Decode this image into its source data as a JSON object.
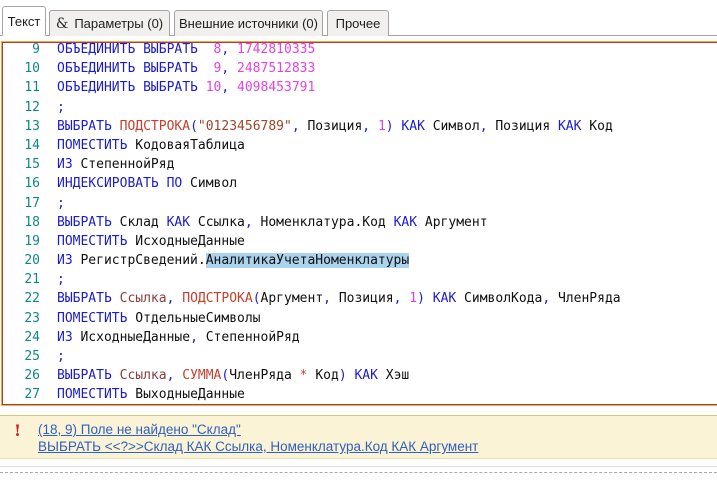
{
  "tabs": [
    {
      "label": "Текст",
      "active": true
    },
    {
      "label": "Параметры (0)",
      "icon_glyph": "&",
      "active": false
    },
    {
      "label": "Внешние источники (0)",
      "active": false
    },
    {
      "label": "Прочее",
      "active": false
    }
  ],
  "editor": {
    "lines": [
      {
        "n": "9",
        "tokens": [
          [
            "kw",
            "ОБЪЕДИНИТЬ ВЫБРАТЬ"
          ],
          [
            "id",
            "  "
          ],
          [
            "num",
            "8"
          ],
          [
            "pun",
            ", "
          ],
          [
            "num",
            "1742810335"
          ]
        ]
      },
      {
        "n": "10",
        "tokens": [
          [
            "kw",
            "ОБЪЕДИНИТЬ ВЫБРАТЬ"
          ],
          [
            "id",
            "  "
          ],
          [
            "num",
            "9"
          ],
          [
            "pun",
            ", "
          ],
          [
            "num",
            "2487512833"
          ]
        ]
      },
      {
        "n": "11",
        "tokens": [
          [
            "kw",
            "ОБЪЕДИНИТЬ ВЫБРАТЬ"
          ],
          [
            "id",
            " "
          ],
          [
            "num",
            "10"
          ],
          [
            "pun",
            ", "
          ],
          [
            "num",
            "4098453791"
          ]
        ]
      },
      {
        "n": "12",
        "tokens": [
          [
            "pun",
            ";"
          ]
        ]
      },
      {
        "n": "13",
        "tokens": [
          [
            "kw",
            "ВЫБРАТЬ"
          ],
          [
            "id",
            " "
          ],
          [
            "fn",
            "ПОДСТРОКА"
          ],
          [
            "pun",
            "("
          ],
          [
            "str",
            "\"0123456789\""
          ],
          [
            "pun",
            ", "
          ],
          [
            "id",
            "Позиция"
          ],
          [
            "pun",
            ", "
          ],
          [
            "num",
            "1"
          ],
          [
            "pun",
            ") "
          ],
          [
            "kw",
            "КАК"
          ],
          [
            "id",
            " Символ"
          ],
          [
            "pun",
            ","
          ],
          [
            "id",
            " Позиция "
          ],
          [
            "kw",
            "КАК"
          ],
          [
            "id",
            " Код"
          ]
        ]
      },
      {
        "n": "14",
        "tokens": [
          [
            "kw",
            "ПОМЕСТИТЬ"
          ],
          [
            "id",
            " КодоваяТаблица"
          ]
        ]
      },
      {
        "n": "15",
        "tokens": [
          [
            "kw",
            "ИЗ"
          ],
          [
            "id",
            " СтепеннойРяд"
          ]
        ]
      },
      {
        "n": "16",
        "tokens": [
          [
            "kw",
            "ИНДЕКСИРОВАТЬ ПО"
          ],
          [
            "id",
            " Символ"
          ]
        ]
      },
      {
        "n": "17",
        "tokens": [
          [
            "pun",
            ";"
          ]
        ]
      },
      {
        "n": "18",
        "tokens": [
          [
            "kw",
            "ВЫБРАТЬ"
          ],
          [
            "id",
            " Склад "
          ],
          [
            "kw",
            "КАК"
          ],
          [
            "id",
            " Ссылка"
          ],
          [
            "pun",
            ","
          ],
          [
            "id",
            " Номенклатура.Код "
          ],
          [
            "kw",
            "КАК"
          ],
          [
            "id",
            " Аргумент"
          ]
        ]
      },
      {
        "n": "19",
        "tokens": [
          [
            "kw",
            "ПОМЕСТИТЬ"
          ],
          [
            "id",
            " ИсходныеДанные"
          ]
        ]
      },
      {
        "n": "20",
        "tokens": [
          [
            "kw",
            "ИЗ"
          ],
          [
            "id",
            " РегистрСведений."
          ],
          [
            "sel",
            "АналитикаУчетаНоменклатуры"
          ]
        ]
      },
      {
        "n": "21",
        "tokens": [
          [
            "pun",
            ";"
          ]
        ]
      },
      {
        "n": "22",
        "tokens": [
          [
            "kw",
            "ВЫБРАТЬ"
          ],
          [
            "id",
            " "
          ],
          [
            "fld",
            "Ссылка"
          ],
          [
            "pun",
            ", "
          ],
          [
            "fn",
            "ПОДСТРОКА"
          ],
          [
            "pun",
            "("
          ],
          [
            "id",
            "Аргумент"
          ],
          [
            "pun",
            ", "
          ],
          [
            "id",
            "Позиция"
          ],
          [
            "pun",
            ", "
          ],
          [
            "num",
            "1"
          ],
          [
            "pun",
            ") "
          ],
          [
            "kw",
            "КАК"
          ],
          [
            "id",
            " СимволКода"
          ],
          [
            "pun",
            ","
          ],
          [
            "id",
            " ЧленРяда"
          ]
        ]
      },
      {
        "n": "23",
        "tokens": [
          [
            "kw",
            "ПОМЕСТИТЬ"
          ],
          [
            "id",
            " ОтдельныеСимволы"
          ]
        ]
      },
      {
        "n": "24",
        "tokens": [
          [
            "kw",
            "ИЗ"
          ],
          [
            "id",
            " ИсходныеДанные"
          ],
          [
            "pun",
            ","
          ],
          [
            "id",
            " СтепеннойРяд"
          ]
        ]
      },
      {
        "n": "25",
        "tokens": [
          [
            "pun",
            ";"
          ]
        ]
      },
      {
        "n": "26",
        "tokens": [
          [
            "kw",
            "ВЫБРАТЬ"
          ],
          [
            "id",
            " "
          ],
          [
            "fld",
            "Ссылка"
          ],
          [
            "pun",
            ", "
          ],
          [
            "fn",
            "СУММА"
          ],
          [
            "pun",
            "("
          ],
          [
            "id",
            "ЧленРяда "
          ],
          [
            "op",
            "*"
          ],
          [
            "id",
            " Код"
          ],
          [
            "pun",
            ") "
          ],
          [
            "kw",
            "КАК"
          ],
          [
            "id",
            " Хэш"
          ]
        ]
      },
      {
        "n": "27",
        "tokens": [
          [
            "kw",
            "ПОМЕСТИТЬ"
          ],
          [
            "id",
            " ВыходныеДанные"
          ]
        ]
      }
    ]
  },
  "errors": {
    "icon_glyph": "!",
    "items": [
      "(18, 9) Поле не найдено \"Склад\"",
      "ВЫБРАТЬ <<?>>Склад КАК Ссылка, Номенклатура.Код КАК Аргумент"
    ]
  },
  "colors": {
    "keyword": "#1c1ccd",
    "function": "#c6402c",
    "number": "#e243e2",
    "string": "#a04527",
    "line_number": "#118686",
    "selection_bg": "#abd3ee",
    "editor_border_outer": "#dfb345",
    "editor_border_inner": "#bf3636",
    "error_panel_bg": "#fbf3d5",
    "error_link": "#2f5fc2",
    "error_icon": "#cc1f1f"
  }
}
